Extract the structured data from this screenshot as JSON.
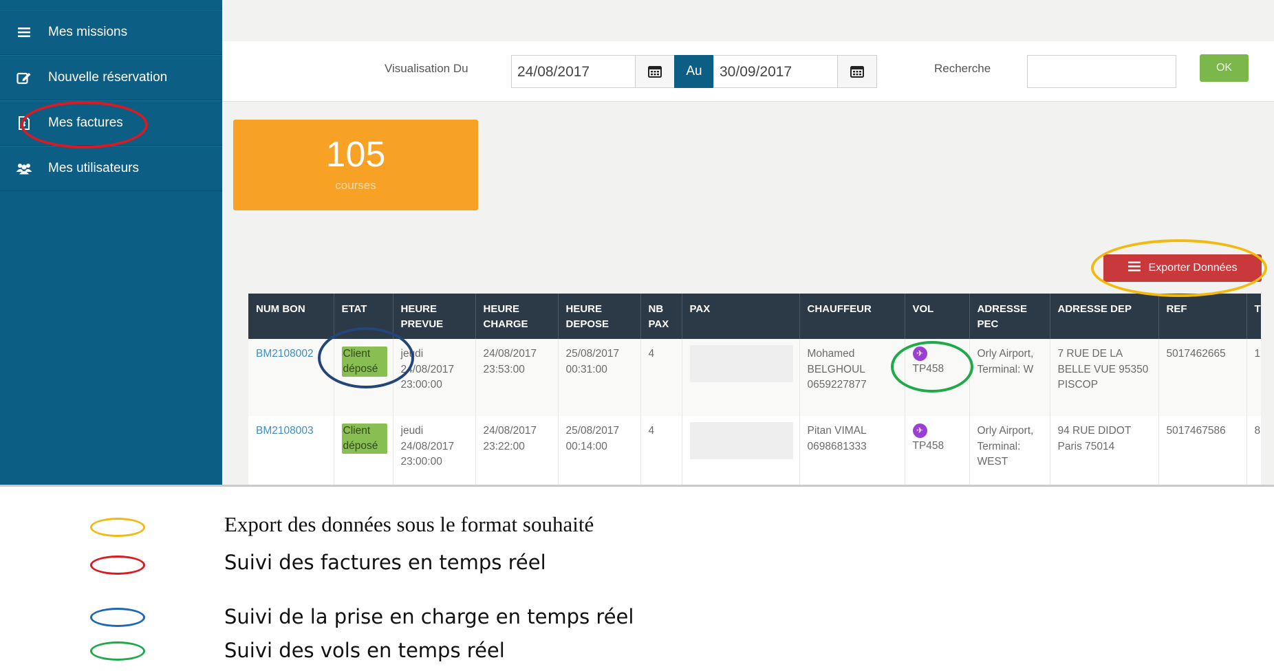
{
  "sidebar": {
    "items": [
      {
        "label": "Mes missions",
        "icon": "hamburger-icon"
      },
      {
        "label": "Nouvelle réservation",
        "icon": "edit-icon"
      },
      {
        "label": "Mes factures",
        "icon": "invoice-icon"
      },
      {
        "label": "Mes utilisateurs",
        "icon": "users-icon"
      }
    ]
  },
  "filters": {
    "from_label": "Visualisation Du",
    "from_date": "24/08/2017",
    "to_label": "Au",
    "to_date": "30/09/2017",
    "search_label": "Recherche",
    "search_value": "",
    "ok_label": "OK"
  },
  "stats": {
    "count": "105",
    "label": "courses"
  },
  "export": {
    "label": "Exporter Données"
  },
  "table": {
    "headers": [
      "NUM BON",
      "ETAT",
      "HEURE PREVUE",
      "HEURE CHARGE",
      "HEURE DEPOSE",
      "NB PAX",
      "PAX",
      "CHAUFFEUR",
      "VOL",
      "ADRESSE PEC",
      "ADRESSE DEP",
      "REF",
      "T"
    ],
    "rows": [
      {
        "num": "BM2108002",
        "etat": "Client déposé",
        "prevue": "jeudi 24/08/2017 23:00:00",
        "charge": "24/08/2017 23:53:00",
        "depose": "25/08/2017 00:31:00",
        "nbpax": "4",
        "pax": "",
        "chauffeur": "Mohamed BELGHOUL 0659227877",
        "vol": "TP458",
        "pec": "Orly Airport, Terminal: W",
        "dep": "7 RUE DE LA BELLE VUE 95350 PISCOP",
        "ref": "5017462665",
        "t": "1"
      },
      {
        "num": "BM2108003",
        "etat": "Client déposé",
        "prevue": "jeudi 24/08/2017 23:00:00",
        "charge": "24/08/2017 23:22:00",
        "depose": "25/08/2017 00:14:00",
        "nbpax": "4",
        "pax": "",
        "chauffeur": "Pitan VIMAL 0698681333",
        "vol": "TP458",
        "pec": "Orly Airport, Terminal: WEST",
        "dep": "94 RUE DIDOT Paris 75014",
        "ref": "5017467586",
        "t": "8"
      }
    ]
  },
  "legend": [
    {
      "color": "#f2b90f",
      "text": "Export des données sous le format souhaité"
    },
    {
      "color": "#d91a21",
      "text": "Suivi des factures en temps réel"
    },
    {
      "color": "#1e67b3",
      "text": "Suivi de la prise en charge en temps réel"
    },
    {
      "color": "#1faa4a",
      "text": "Suivi des vols en temps réel"
    }
  ],
  "colors": {
    "sidebar": "#0d5e84",
    "card": "#f7a225",
    "export": "#c9393c",
    "ok": "#7cb74b",
    "table_header": "#2b3a46",
    "state_badge": "#89be52",
    "flight_icon": "#9b3fd4"
  }
}
